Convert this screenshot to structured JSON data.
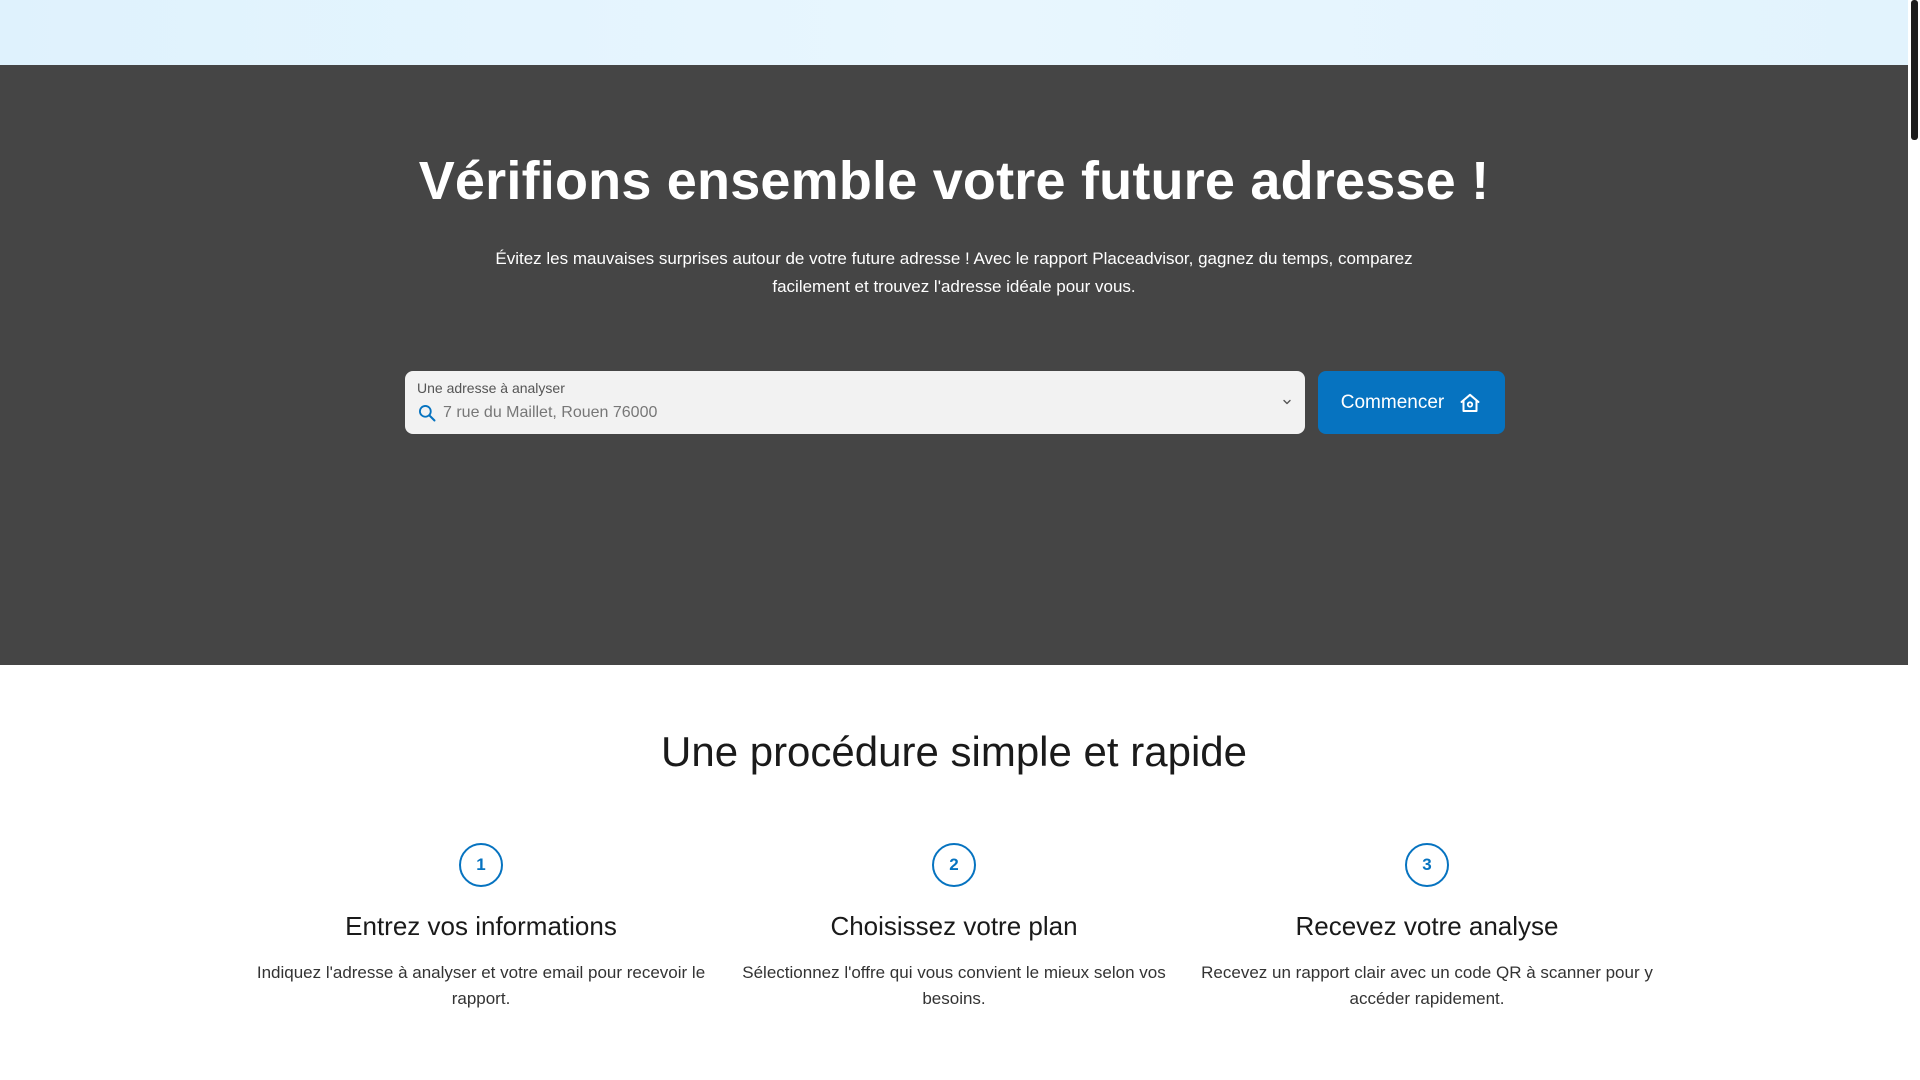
{
  "hero": {
    "title": "Vérifions ensemble votre future adresse !",
    "subtitle": "Évitez les mauvaises surprises autour de votre future adresse ! Avec le rapport Placeadvisor, gagnez du temps, comparez facilement et trouvez l'adresse idéale pour vous.",
    "search": {
      "label": "Une adresse à analyser",
      "placeholder": "7 rue du Maillet, Rouen 76000",
      "value": "",
      "icon": "search-icon",
      "dropdown_icon": "chevron-down-icon"
    },
    "start_button": {
      "label": "Commencer",
      "icon": "home-icon"
    }
  },
  "steps_section": {
    "title": "Une procédure simple et rapide",
    "steps": [
      {
        "number": "1",
        "title": "Entrez vos informations",
        "text": "Indiquez l'adresse à analyser et votre email pour recevoir le rapport."
      },
      {
        "number": "2",
        "title": "Choisissez votre plan",
        "text": "Sélectionnez l'offre qui vous convient le mieux selon vos besoins."
      },
      {
        "number": "3",
        "title": "Recevez votre analyse",
        "text": "Recevez un rapport clair avec un code QR à scanner pour y accéder rapidement."
      }
    ]
  },
  "colors": {
    "hero_background": "#454545",
    "accent": "#0673c0",
    "topbar": "#e3f4fd"
  }
}
